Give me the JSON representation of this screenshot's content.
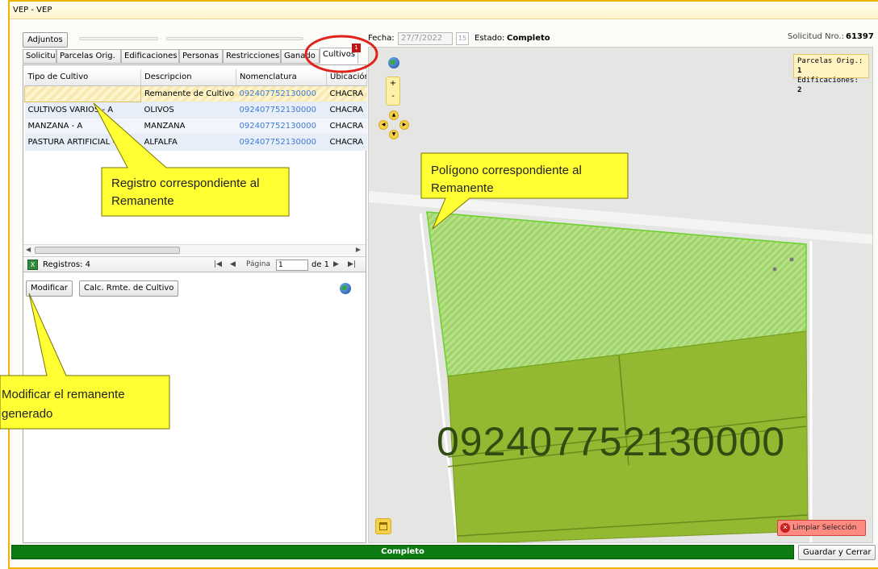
{
  "window": {
    "title": "VEP - VEP"
  },
  "header": {
    "adjuntos_tab": "Adjuntos",
    "fecha_label": "Fecha:",
    "fecha_value": "27/7/2022",
    "calendar_label": "15",
    "estado_label": "Estado:",
    "estado_value": "Completo",
    "solicitud_label": "Solicitud Nro.:",
    "solicitud_value": "61397"
  },
  "tabs": [
    {
      "label": "Solicitud"
    },
    {
      "label": "Parcelas Orig."
    },
    {
      "label": "Edificaciones"
    },
    {
      "label": "Personas"
    },
    {
      "label": "Restricciones"
    },
    {
      "label": "Ganado"
    },
    {
      "label": "Cultivos",
      "badge": "1",
      "active": true
    }
  ],
  "grid": {
    "columns": [
      "Tipo de Cultivo",
      "Descripcion",
      "Nomenclatura",
      "Ubicación"
    ],
    "rows": [
      {
        "tipo": "",
        "descripcion": "Remanente de Cultivo",
        "nomenclatura": "092407752130000",
        "ubicacion": "CHACRA"
      },
      {
        "tipo": "CULTIVOS VARIOS - A",
        "descripcion": "OLIVOS",
        "nomenclatura": "092407752130000",
        "ubicacion": "CHACRA"
      },
      {
        "tipo": "MANZANA - A",
        "descripcion": "MANZANA",
        "nomenclatura": "092407752130000",
        "ubicacion": "CHACRA"
      },
      {
        "tipo": "PASTURA ARTIFICIAL - A",
        "descripcion": "ALFALFA",
        "nomenclatura": "092407752130000",
        "ubicacion": "CHACRA"
      }
    ]
  },
  "pager": {
    "registros": "Registros: 4",
    "first": "|◀",
    "prev": "◀",
    "pagina_label": "Página",
    "page_value": "1",
    "de_label": "de 1",
    "next": "▶",
    "last": "▶|"
  },
  "actions": {
    "modificar": "Modificar",
    "calc": "Calc. Rmte. de Cultivo"
  },
  "map": {
    "zoom_in": "+",
    "zoom_out": "-",
    "info_parcelas_label": "Parcelas Orig.:",
    "info_parcelas_value": "1",
    "info_edificaciones_label": "Edificaciones:",
    "info_edificaciones_value": "2",
    "parcel_label": "092407752130000",
    "limpiar": "Limpiar Selección"
  },
  "footer": {
    "status": "Completo",
    "guardar": "Guardar y Cerrar"
  },
  "callouts": {
    "registro": [
      "Registro correspondiente al",
      "Remanente"
    ],
    "poligono": [
      "Polígono correspondiente al",
      "Remanente"
    ],
    "modificar": [
      "Modificar el remanente",
      "generado"
    ]
  },
  "colors": {
    "frame_border": "#f0b400",
    "status_green": "#0d7a12",
    "callout_fill": "#ffff33",
    "parcel_fill": "#93b832",
    "remanente_fill": "#9fd468",
    "highlight_red": "#e0231c"
  }
}
